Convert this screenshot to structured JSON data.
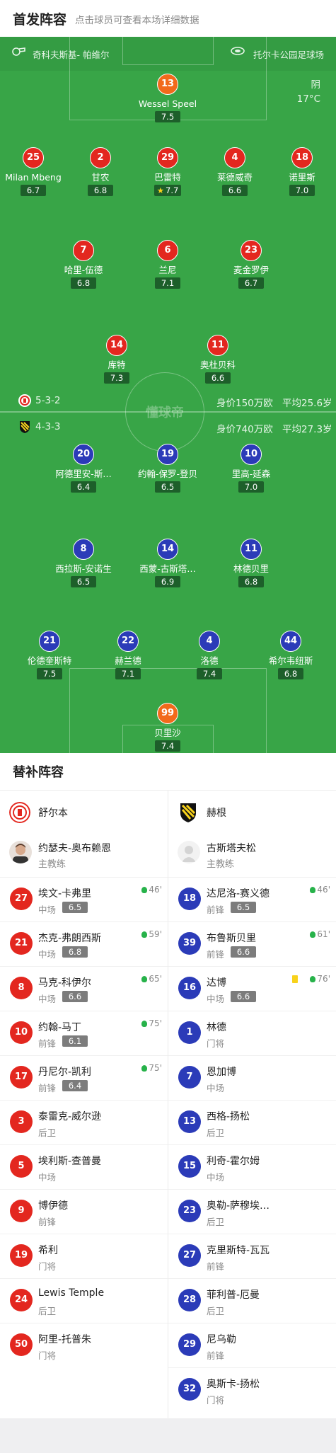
{
  "header": {
    "title": "首发阵容",
    "subtitle": "点击球员可查看本场详细数据"
  },
  "match_info": {
    "referee": "奇科夫斯基- 帕维尔",
    "stadium": "托尔卡公园足球场",
    "weather": "阴",
    "temperature": "17°C"
  },
  "home_team": {
    "name": "舒尔本",
    "formation": "5-3-2",
    "value": "身价150万欧",
    "avg_age": "平均25.6岁",
    "color": "#e3271f"
  },
  "away_team": {
    "name": "赫根",
    "formation": "4-3-3",
    "value": "身价740万欧",
    "avg_age": "平均27.3岁",
    "color": "#2b3bb8"
  },
  "watermark": "懂球帝",
  "home_players": [
    {
      "num": "13",
      "name": "Wessel Speel",
      "rating": "7.5"
    },
    {
      "num": "25",
      "name": "Milan Mbeng",
      "rating": "6.7"
    },
    {
      "num": "2",
      "name": "甘农",
      "rating": "6.8",
      "sub": "65'"
    },
    {
      "num": "29",
      "name": "巴雷特",
      "rating": "7.7",
      "captain": "C"
    },
    {
      "num": "4",
      "name": "莱德威奇",
      "rating": "6.6",
      "sub": "46'"
    },
    {
      "num": "18",
      "name": "诺里斯",
      "rating": "7.0",
      "yellow": true
    },
    {
      "num": "7",
      "name": "哈里-伍德",
      "rating": "6.8",
      "sub": "75'"
    },
    {
      "num": "6",
      "name": "兰尼",
      "rating": "7.1"
    },
    {
      "num": "23",
      "name": "麦金罗伊",
      "rating": "6.7"
    },
    {
      "num": "14",
      "name": "库特",
      "rating": "7.3",
      "sub": "59'"
    },
    {
      "num": "11",
      "name": "奥杜贝科",
      "rating": "6.6",
      "sub": "75'"
    }
  ],
  "away_players": [
    {
      "num": "20",
      "name": "阿德里安-斯…",
      "rating": "6.4"
    },
    {
      "num": "19",
      "name": "约翰-保罗-登贝",
      "rating": "6.5",
      "sub": "61'"
    },
    {
      "num": "10",
      "name": "里高-延森",
      "rating": "7.0",
      "sub": "76'"
    },
    {
      "num": "8",
      "name": "西拉斯-安诺生",
      "rating": "6.5"
    },
    {
      "num": "14",
      "name": "西蒙-古斯塔…",
      "rating": "6.9",
      "captain": "C"
    },
    {
      "num": "11",
      "name": "林德贝里",
      "rating": "6.8"
    },
    {
      "num": "21",
      "name": "伦德奎斯特",
      "rating": "7.5"
    },
    {
      "num": "22",
      "name": "赫兰德",
      "rating": "7.1",
      "yellow": true
    },
    {
      "num": "4",
      "name": "洛德",
      "rating": "7.4"
    },
    {
      "num": "44",
      "name": "希尔韦纽斯",
      "rating": "6.8",
      "sub": "46'"
    },
    {
      "num": "99",
      "name": "贝里沙",
      "rating": "7.4"
    }
  ],
  "subs": {
    "title": "替补阵容",
    "home_coach": {
      "name": "约瑟夫-奥布赖恩",
      "role": "主教练"
    },
    "away_coach": {
      "name": "古斯塔夫松",
      "role": "主教练"
    },
    "home": [
      {
        "num": "27",
        "name": "埃文-卡弗里",
        "pos": "中场",
        "rating": "6.5",
        "in": "46'"
      },
      {
        "num": "21",
        "name": "杰克-弗朗西斯",
        "pos": "中场",
        "rating": "6.8",
        "in": "59'"
      },
      {
        "num": "8",
        "name": "马克-科伊尔",
        "pos": "中场",
        "rating": "6.6",
        "in": "65'"
      },
      {
        "num": "10",
        "name": "约翰-马丁",
        "pos": "前锋",
        "rating": "6.1",
        "in": "75'"
      },
      {
        "num": "17",
        "name": "丹尼尔-凯利",
        "pos": "前锋",
        "rating": "6.4",
        "in": "75'"
      },
      {
        "num": "3",
        "name": "泰雷克-威尔逊",
        "pos": "后卫"
      },
      {
        "num": "5",
        "name": "埃利斯-查普曼",
        "pos": "中场"
      },
      {
        "num": "9",
        "name": "博伊德",
        "pos": "前锋"
      },
      {
        "num": "19",
        "name": "希利",
        "pos": "门将"
      },
      {
        "num": "24",
        "name": "Lewis Temple",
        "pos": "后卫"
      },
      {
        "num": "50",
        "name": "阿里-托普朱",
        "pos": "门将"
      }
    ],
    "away": [
      {
        "num": "18",
        "name": "达尼洛-赛义德",
        "pos": "前锋",
        "rating": "6.5",
        "in": "46'"
      },
      {
        "num": "39",
        "name": "布鲁斯贝里",
        "pos": "前锋",
        "rating": "6.6",
        "in": "61'"
      },
      {
        "num": "16",
        "name": "达博",
        "pos": "中场",
        "rating": "6.6",
        "in": "76'",
        "yellow": true
      },
      {
        "num": "1",
        "name": "林德",
        "pos": "门将"
      },
      {
        "num": "7",
        "name": "恩加博",
        "pos": "中场"
      },
      {
        "num": "13",
        "name": "西格-扬松",
        "pos": "后卫"
      },
      {
        "num": "15",
        "name": "利奇-霍尔姆",
        "pos": "中场"
      },
      {
        "num": "23",
        "name": "奥勒-萨穆埃…",
        "pos": "后卫"
      },
      {
        "num": "27",
        "name": "克里斯特-瓦瓦",
        "pos": "前锋"
      },
      {
        "num": "28",
        "name": "菲利普-厄曼",
        "pos": "后卫"
      },
      {
        "num": "29",
        "name": "尼乌勒",
        "pos": "前锋"
      },
      {
        "num": "32",
        "name": "奥斯卡-扬松",
        "pos": "门将"
      }
    ]
  }
}
